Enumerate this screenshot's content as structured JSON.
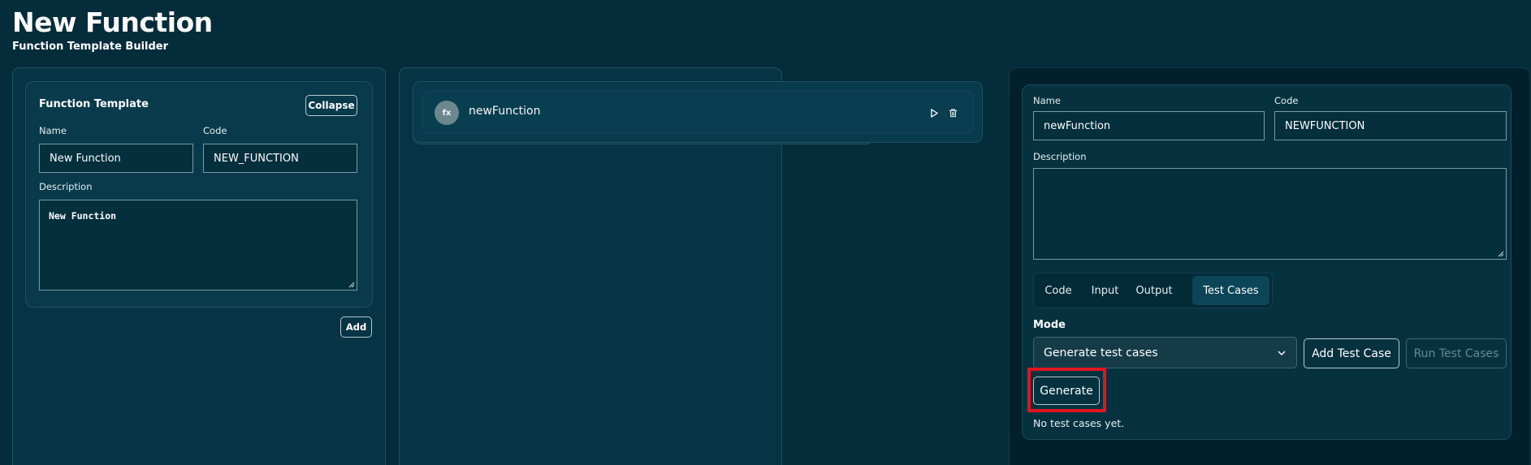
{
  "header": {
    "title": "New Function",
    "subtitle": "Function Template Builder"
  },
  "template_card": {
    "title": "Function Template",
    "collapse_label": "Collapse",
    "name_label": "Name",
    "name_value": "New Function",
    "code_label": "Code",
    "code_value": "NEW_FUNCTION",
    "description_label": "Description",
    "description_value": "New Function",
    "add_label": "Add"
  },
  "function_list": {
    "items": [
      {
        "avatar": "fx",
        "name": "newFunction",
        "icons": [
          "play-icon",
          "trash-icon"
        ]
      }
    ]
  },
  "details": {
    "name_label": "Name",
    "name_value": "newFunction",
    "code_label": "Code",
    "code_value": "NEWFUNCTION",
    "description_label": "Description",
    "description_value": "",
    "tabs": [
      "Code",
      "Input",
      "Output",
      "Test Cases"
    ],
    "active_tab": "Test Cases",
    "mode_label": "Mode",
    "mode_selected": "Generate test cases",
    "add_test_case_label": "Add Test Case",
    "run_test_cases_label": "Run Test Cases",
    "generate_label": "Generate",
    "empty_message": "No test cases yet."
  },
  "colors": {
    "background": "#052c3a",
    "panel": "#073444",
    "highlight": "#e3141f"
  }
}
